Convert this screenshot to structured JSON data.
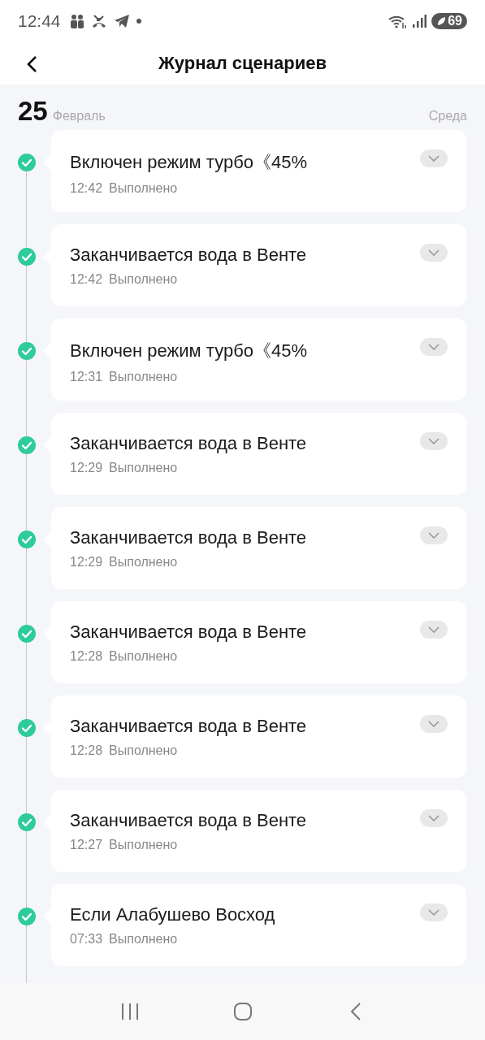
{
  "status_bar": {
    "time": "12:44",
    "battery": "69"
  },
  "header": {
    "title": "Журнал сценариев"
  },
  "date": {
    "day": "25",
    "month": "Февраль",
    "weekday": "Среда"
  },
  "entries": [
    {
      "title": "Включен режим турбо《45%",
      "time": "12:42",
      "status": "Выполнено",
      "done": true
    },
    {
      "title": "Заканчивается вода в Венте",
      "time": "12:42",
      "status": "Выполнено",
      "done": true
    },
    {
      "title": "Включен режим турбо《45%",
      "time": "12:31",
      "status": "Выполнено",
      "done": true
    },
    {
      "title": "Заканчивается вода в Венте",
      "time": "12:29",
      "status": "Выполнено",
      "done": true
    },
    {
      "title": "Заканчивается вода в Венте",
      "time": "12:29",
      "status": "Выполнено",
      "done": true
    },
    {
      "title": "Заканчивается вода в Венте",
      "time": "12:28",
      "status": "Выполнено",
      "done": true
    },
    {
      "title": "Заканчивается вода в Венте",
      "time": "12:28",
      "status": "Выполнено",
      "done": true
    },
    {
      "title": "Заканчивается вода в Венте",
      "time": "12:27",
      "status": "Выполнено",
      "done": true
    },
    {
      "title": "Если Алабушево Восход",
      "time": "07:33",
      "status": "Выполнено",
      "done": true
    }
  ]
}
